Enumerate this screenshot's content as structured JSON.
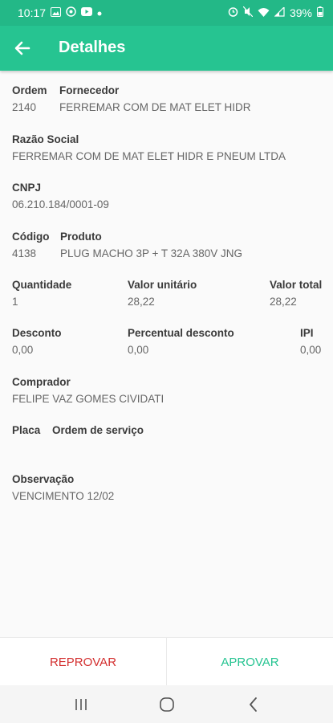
{
  "status": {
    "time": "10:17",
    "battery": "39%"
  },
  "header": {
    "title": "Detalhes"
  },
  "details": {
    "ordem_label": "Ordem",
    "ordem_value": "2140",
    "fornecedor_label": "Fornecedor",
    "fornecedor_value": "FERREMAR COM DE MAT ELET HIDR",
    "razao_label": "Razão Social",
    "razao_value": "FERREMAR COM DE MAT ELET HIDR E PNEUM LTDA",
    "cnpj_label": "CNPJ",
    "cnpj_value": "06.210.184/0001-09",
    "codigo_label": "Código",
    "codigo_value": "4138",
    "produto_label": "Produto",
    "produto_value": "PLUG MACHO 3P + T 32A 380V JNG",
    "quantidade_label": "Quantidade",
    "quantidade_value": "1",
    "valor_unitario_label": "Valor unitário",
    "valor_unitario_value": "28,22",
    "valor_total_label": "Valor total",
    "valor_total_value": "28,22",
    "desconto_label": "Desconto",
    "desconto_value": "0,00",
    "percentual_label": "Percentual desconto",
    "percentual_value": "0,00",
    "ipi_label": "IPI",
    "ipi_value": "0,00",
    "comprador_label": "Comprador",
    "comprador_value": "FELIPE VAZ GOMES CIVIDATI",
    "placa_label": "Placa",
    "ordem_servico_label": "Ordem de serviço",
    "observacao_label": "Observação",
    "observacao_value": "VENCIMENTO 12/02"
  },
  "actions": {
    "reject": "REPROVAR",
    "approve": "APROVAR"
  },
  "colors": {
    "primary": "#26c491",
    "status_bar": "#23b887",
    "reject": "#d32f2f"
  }
}
